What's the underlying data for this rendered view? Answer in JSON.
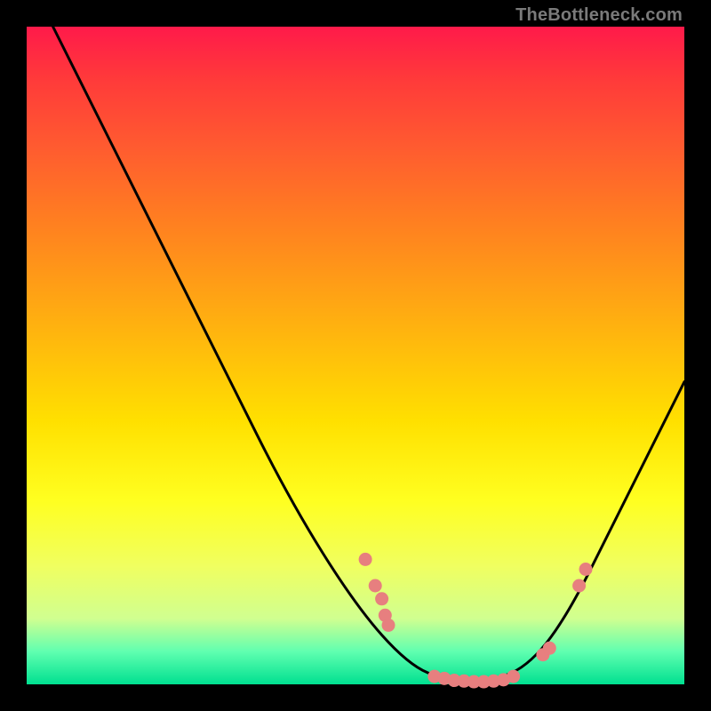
{
  "attribution": "TheBottleneck.com",
  "chart_data": {
    "type": "line",
    "title": "",
    "xlabel": "",
    "ylabel": "",
    "x_range": [
      0,
      100
    ],
    "y_range": [
      0,
      100
    ],
    "curve": [
      {
        "x": 4.0,
        "y": 100.0
      },
      {
        "x": 10.0,
        "y": 88.0
      },
      {
        "x": 20.0,
        "y": 68.0
      },
      {
        "x": 30.0,
        "y": 48.0
      },
      {
        "x": 40.0,
        "y": 28.0
      },
      {
        "x": 50.0,
        "y": 12.0
      },
      {
        "x": 58.0,
        "y": 3.0
      },
      {
        "x": 64.0,
        "y": 0.5
      },
      {
        "x": 70.0,
        "y": 0.4
      },
      {
        "x": 76.0,
        "y": 2.5
      },
      {
        "x": 82.0,
        "y": 10.0
      },
      {
        "x": 90.0,
        "y": 26.0
      },
      {
        "x": 100.0,
        "y": 46.0
      }
    ],
    "points": [
      {
        "x": 51.5,
        "y": 19.0
      },
      {
        "x": 53.0,
        "y": 15.0
      },
      {
        "x": 54.0,
        "y": 13.0
      },
      {
        "x": 54.5,
        "y": 10.5
      },
      {
        "x": 55.0,
        "y": 9.0
      },
      {
        "x": 62.0,
        "y": 1.2
      },
      {
        "x": 63.5,
        "y": 0.9
      },
      {
        "x": 65.0,
        "y": 0.6
      },
      {
        "x": 66.5,
        "y": 0.5
      },
      {
        "x": 68.0,
        "y": 0.4
      },
      {
        "x": 69.5,
        "y": 0.4
      },
      {
        "x": 71.0,
        "y": 0.5
      },
      {
        "x": 72.5,
        "y": 0.7
      },
      {
        "x": 74.0,
        "y": 1.2
      },
      {
        "x": 78.5,
        "y": 4.5
      },
      {
        "x": 79.5,
        "y": 5.5
      },
      {
        "x": 84.0,
        "y": 15.0
      },
      {
        "x": 85.0,
        "y": 17.5
      }
    ],
    "colors": {
      "curve": "#000000",
      "points": "#e77f7f"
    }
  }
}
